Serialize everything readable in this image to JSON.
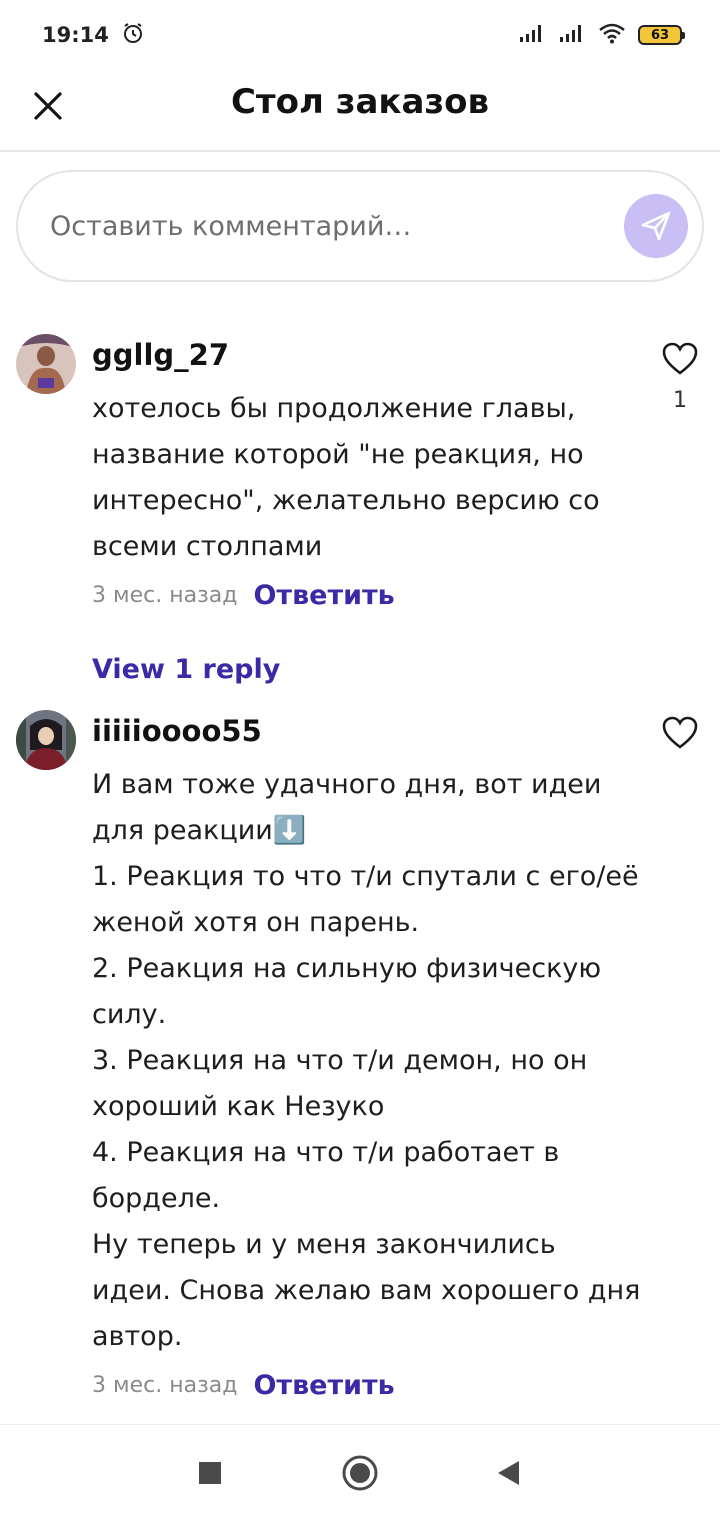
{
  "status_bar": {
    "time": "19:14",
    "battery": "63",
    "icons": [
      "alarm-icon",
      "signal-icon",
      "signal-icon",
      "wifi-icon",
      "battery-icon"
    ]
  },
  "header": {
    "title": "Стол заказов",
    "close_icon": "close-icon"
  },
  "comment_input": {
    "placeholder": "Оставить комментарий…",
    "send_icon": "send-icon",
    "send_color": "#c9bff4"
  },
  "comments": [
    {
      "username": "ggllg_27",
      "text": "хотелось бы продолжение главы,\nназвание которой \"не реакция, но\nинтересно\", желательно версию со\nвсеми столпами",
      "time": "3 мес. назад",
      "reply_label": "Ответить",
      "likes": "1",
      "view_replies": "View 1 reply"
    },
    {
      "username": "iiiiioooo55",
      "text": "И вам тоже удачного дня, вот идеи\nдля реакции⬇️\n1. Реакция то что т/и спутали с его/её\nженой хотя он парень.\n2. Реакция на сильную физическую\nсилу.\n3. Реакция на что т/и демон, но он\nхороший как Незуко\n4. Реакция на что т/и работает в\nборделе.\nНу теперь и у меня закончились\nидеи. Снова желаю вам хорошего дня\nавтор.",
      "time": "3 мес. назад",
      "reply_label": "Ответить"
    }
  ],
  "colors": {
    "accent": "#3b2aa6",
    "send_button": "#c9bff4"
  },
  "nav_bar": {
    "icons": [
      "recent-apps-icon",
      "home-icon",
      "back-icon"
    ]
  }
}
